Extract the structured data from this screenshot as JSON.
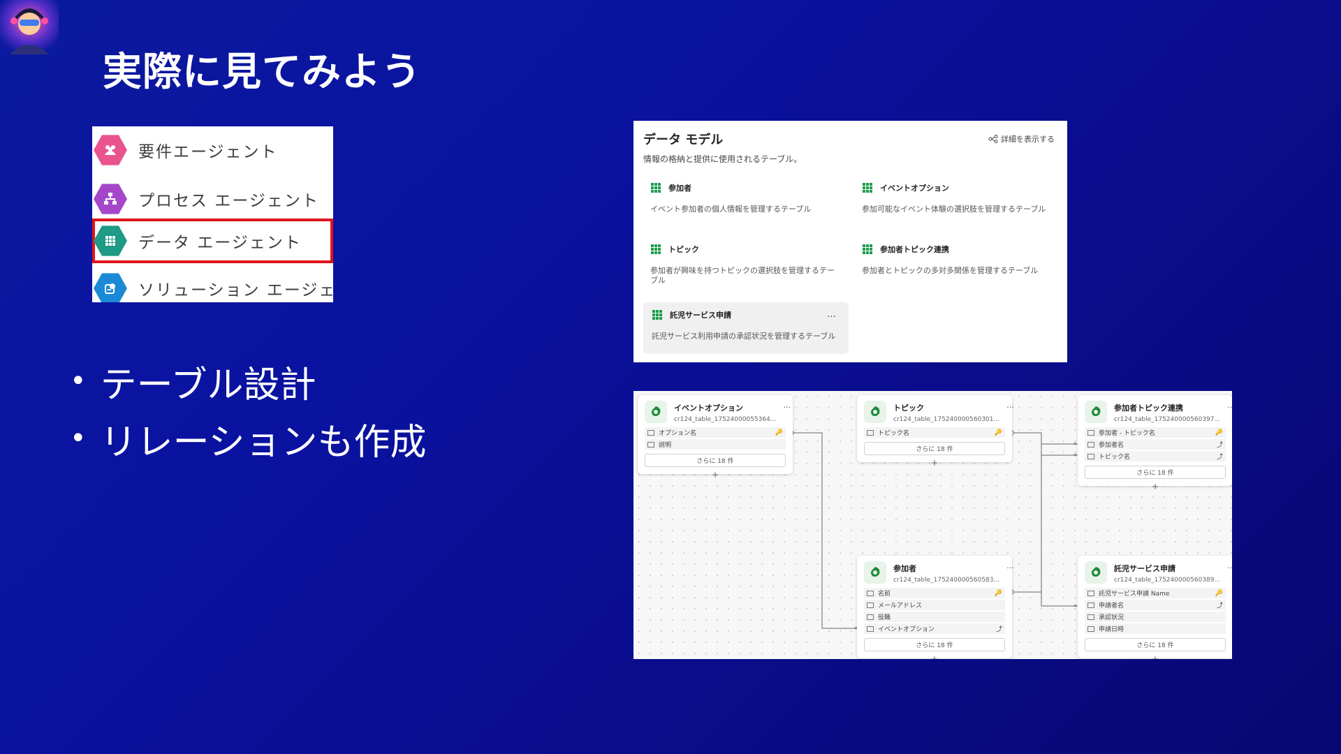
{
  "slide": {
    "title": "実際に見てみよう"
  },
  "agents": [
    {
      "label": "要件エージェント",
      "color": "#e9548f",
      "icon": "people-icon"
    },
    {
      "label": "プロセス エージェント",
      "color": "#a547c9",
      "icon": "process-icon"
    },
    {
      "label": "データ エージェント",
      "color": "#1e9a86",
      "icon": "grid-icon",
      "selected": true
    },
    {
      "label": "ソリューション エージェン",
      "color": "#1b8ad6",
      "icon": "solution-icon"
    }
  ],
  "bullets": [
    "テーブル設計",
    "リレーションも作成"
  ],
  "data_model": {
    "title": "データ モデル",
    "subtitle": "情報の格納と提供に使用されるテーブル。",
    "detail_link": "詳細を表示する",
    "tables": [
      {
        "name": "参加者",
        "desc": "イベント参加者の個人情報を管理するテーブル"
      },
      {
        "name": "イベントオプション",
        "desc": "参加可能なイベント体験の選択肢を管理するテーブル"
      },
      {
        "name": "トピック",
        "desc": "参加者が興味を持つトピックの選択肢を管理するテーブル"
      },
      {
        "name": "参加者トピック連携",
        "desc": "参加者とトピックの多対多関係を管理するテーブル"
      },
      {
        "name": "託児サービス申請",
        "desc": "託児サービス利用申請の承認状況を管理するテーブル",
        "more": "…"
      }
    ]
  },
  "erd": {
    "nodes": [
      {
        "title": "イベントオプション",
        "id": "cr124_table_17524000055364...",
        "columns": [
          "オプション名",
          "説明"
        ],
        "more": "さらに 18 件"
      },
      {
        "title": "トピック",
        "id": "cr124_table_175240000560301...",
        "columns": [
          "トピック名"
        ],
        "more": "さらに 18 件"
      },
      {
        "title": "参加者トピック連携",
        "id": "cr124_table_175240000560397...",
        "columns": [
          "参加者 - トピック名",
          "参加者名",
          "トピック名"
        ],
        "more": "さらに 18 件"
      },
      {
        "title": "参加者",
        "id": "cr124_table_175240000560583...",
        "columns": [
          "名前",
          "メールアドレス",
          "役職",
          "イベントオプション"
        ],
        "more": "さらに 18 件"
      },
      {
        "title": "託児サービス申請",
        "id": "cr124_table_175240000560389...",
        "columns": [
          "託児サービス申請 Name",
          "申請者名",
          "承認状況",
          "申請日時"
        ],
        "more": "さらに 18 件"
      }
    ]
  }
}
